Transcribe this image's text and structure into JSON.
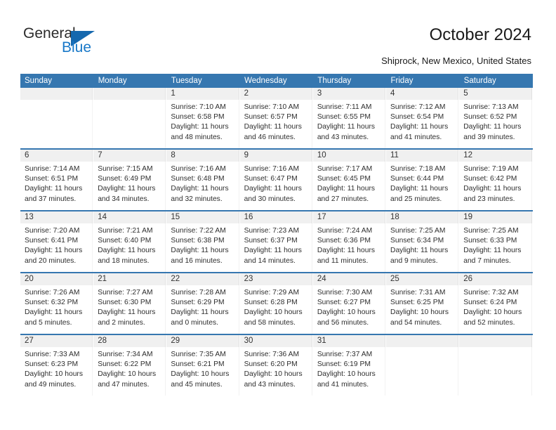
{
  "brand": {
    "name_part1": "General",
    "name_part2": "Blue",
    "triangle_color": "#1568ae",
    "blue_text_color": "#1878c8"
  },
  "header": {
    "title": "October 2024",
    "subtitle": "Shiprock, New Mexico, United States",
    "header_bg": "#3677b0",
    "daynum_band_bg": "#f0f0f0"
  },
  "weekday_headers": [
    "Sunday",
    "Monday",
    "Tuesday",
    "Wednesday",
    "Thursday",
    "Friday",
    "Saturday"
  ],
  "weeks": [
    [
      {
        "day": "",
        "sunrise": "",
        "sunset": "",
        "daylight_1": "",
        "daylight_2": ""
      },
      {
        "day": "",
        "sunrise": "",
        "sunset": "",
        "daylight_1": "",
        "daylight_2": ""
      },
      {
        "day": "1",
        "sunrise": "Sunrise: 7:10 AM",
        "sunset": "Sunset: 6:58 PM",
        "daylight_1": "Daylight: 11 hours",
        "daylight_2": "and 48 minutes."
      },
      {
        "day": "2",
        "sunrise": "Sunrise: 7:10 AM",
        "sunset": "Sunset: 6:57 PM",
        "daylight_1": "Daylight: 11 hours",
        "daylight_2": "and 46 minutes."
      },
      {
        "day": "3",
        "sunrise": "Sunrise: 7:11 AM",
        "sunset": "Sunset: 6:55 PM",
        "daylight_1": "Daylight: 11 hours",
        "daylight_2": "and 43 minutes."
      },
      {
        "day": "4",
        "sunrise": "Sunrise: 7:12 AM",
        "sunset": "Sunset: 6:54 PM",
        "daylight_1": "Daylight: 11 hours",
        "daylight_2": "and 41 minutes."
      },
      {
        "day": "5",
        "sunrise": "Sunrise: 7:13 AM",
        "sunset": "Sunset: 6:52 PM",
        "daylight_1": "Daylight: 11 hours",
        "daylight_2": "and 39 minutes."
      }
    ],
    [
      {
        "day": "6",
        "sunrise": "Sunrise: 7:14 AM",
        "sunset": "Sunset: 6:51 PM",
        "daylight_1": "Daylight: 11 hours",
        "daylight_2": "and 37 minutes."
      },
      {
        "day": "7",
        "sunrise": "Sunrise: 7:15 AM",
        "sunset": "Sunset: 6:49 PM",
        "daylight_1": "Daylight: 11 hours",
        "daylight_2": "and 34 minutes."
      },
      {
        "day": "8",
        "sunrise": "Sunrise: 7:16 AM",
        "sunset": "Sunset: 6:48 PM",
        "daylight_1": "Daylight: 11 hours",
        "daylight_2": "and 32 minutes."
      },
      {
        "day": "9",
        "sunrise": "Sunrise: 7:16 AM",
        "sunset": "Sunset: 6:47 PM",
        "daylight_1": "Daylight: 11 hours",
        "daylight_2": "and 30 minutes."
      },
      {
        "day": "10",
        "sunrise": "Sunrise: 7:17 AM",
        "sunset": "Sunset: 6:45 PM",
        "daylight_1": "Daylight: 11 hours",
        "daylight_2": "and 27 minutes."
      },
      {
        "day": "11",
        "sunrise": "Sunrise: 7:18 AM",
        "sunset": "Sunset: 6:44 PM",
        "daylight_1": "Daylight: 11 hours",
        "daylight_2": "and 25 minutes."
      },
      {
        "day": "12",
        "sunrise": "Sunrise: 7:19 AM",
        "sunset": "Sunset: 6:42 PM",
        "daylight_1": "Daylight: 11 hours",
        "daylight_2": "and 23 minutes."
      }
    ],
    [
      {
        "day": "13",
        "sunrise": "Sunrise: 7:20 AM",
        "sunset": "Sunset: 6:41 PM",
        "daylight_1": "Daylight: 11 hours",
        "daylight_2": "and 20 minutes."
      },
      {
        "day": "14",
        "sunrise": "Sunrise: 7:21 AM",
        "sunset": "Sunset: 6:40 PM",
        "daylight_1": "Daylight: 11 hours",
        "daylight_2": "and 18 minutes."
      },
      {
        "day": "15",
        "sunrise": "Sunrise: 7:22 AM",
        "sunset": "Sunset: 6:38 PM",
        "daylight_1": "Daylight: 11 hours",
        "daylight_2": "and 16 minutes."
      },
      {
        "day": "16",
        "sunrise": "Sunrise: 7:23 AM",
        "sunset": "Sunset: 6:37 PM",
        "daylight_1": "Daylight: 11 hours",
        "daylight_2": "and 14 minutes."
      },
      {
        "day": "17",
        "sunrise": "Sunrise: 7:24 AM",
        "sunset": "Sunset: 6:36 PM",
        "daylight_1": "Daylight: 11 hours",
        "daylight_2": "and 11 minutes."
      },
      {
        "day": "18",
        "sunrise": "Sunrise: 7:25 AM",
        "sunset": "Sunset: 6:34 PM",
        "daylight_1": "Daylight: 11 hours",
        "daylight_2": "and 9 minutes."
      },
      {
        "day": "19",
        "sunrise": "Sunrise: 7:25 AM",
        "sunset": "Sunset: 6:33 PM",
        "daylight_1": "Daylight: 11 hours",
        "daylight_2": "and 7 minutes."
      }
    ],
    [
      {
        "day": "20",
        "sunrise": "Sunrise: 7:26 AM",
        "sunset": "Sunset: 6:32 PM",
        "daylight_1": "Daylight: 11 hours",
        "daylight_2": "and 5 minutes."
      },
      {
        "day": "21",
        "sunrise": "Sunrise: 7:27 AM",
        "sunset": "Sunset: 6:30 PM",
        "daylight_1": "Daylight: 11 hours",
        "daylight_2": "and 2 minutes."
      },
      {
        "day": "22",
        "sunrise": "Sunrise: 7:28 AM",
        "sunset": "Sunset: 6:29 PM",
        "daylight_1": "Daylight: 11 hours",
        "daylight_2": "and 0 minutes."
      },
      {
        "day": "23",
        "sunrise": "Sunrise: 7:29 AM",
        "sunset": "Sunset: 6:28 PM",
        "daylight_1": "Daylight: 10 hours",
        "daylight_2": "and 58 minutes."
      },
      {
        "day": "24",
        "sunrise": "Sunrise: 7:30 AM",
        "sunset": "Sunset: 6:27 PM",
        "daylight_1": "Daylight: 10 hours",
        "daylight_2": "and 56 minutes."
      },
      {
        "day": "25",
        "sunrise": "Sunrise: 7:31 AM",
        "sunset": "Sunset: 6:25 PM",
        "daylight_1": "Daylight: 10 hours",
        "daylight_2": "and 54 minutes."
      },
      {
        "day": "26",
        "sunrise": "Sunrise: 7:32 AM",
        "sunset": "Sunset: 6:24 PM",
        "daylight_1": "Daylight: 10 hours",
        "daylight_2": "and 52 minutes."
      }
    ],
    [
      {
        "day": "27",
        "sunrise": "Sunrise: 7:33 AM",
        "sunset": "Sunset: 6:23 PM",
        "daylight_1": "Daylight: 10 hours",
        "daylight_2": "and 49 minutes."
      },
      {
        "day": "28",
        "sunrise": "Sunrise: 7:34 AM",
        "sunset": "Sunset: 6:22 PM",
        "daylight_1": "Daylight: 10 hours",
        "daylight_2": "and 47 minutes."
      },
      {
        "day": "29",
        "sunrise": "Sunrise: 7:35 AM",
        "sunset": "Sunset: 6:21 PM",
        "daylight_1": "Daylight: 10 hours",
        "daylight_2": "and 45 minutes."
      },
      {
        "day": "30",
        "sunrise": "Sunrise: 7:36 AM",
        "sunset": "Sunset: 6:20 PM",
        "daylight_1": "Daylight: 10 hours",
        "daylight_2": "and 43 minutes."
      },
      {
        "day": "31",
        "sunrise": "Sunrise: 7:37 AM",
        "sunset": "Sunset: 6:19 PM",
        "daylight_1": "Daylight: 10 hours",
        "daylight_2": "and 41 minutes."
      },
      {
        "day": "",
        "sunrise": "",
        "sunset": "",
        "daylight_1": "",
        "daylight_2": ""
      },
      {
        "day": "",
        "sunrise": "",
        "sunset": "",
        "daylight_1": "",
        "daylight_2": ""
      }
    ]
  ]
}
